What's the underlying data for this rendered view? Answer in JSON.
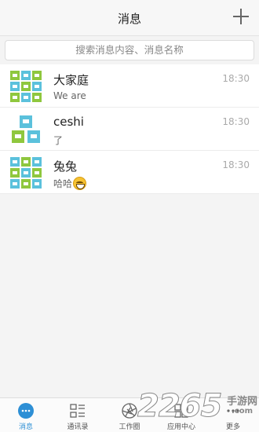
{
  "header": {
    "title": "消息"
  },
  "search": {
    "placeholder": "搜索消息内容、消息名称"
  },
  "conversations": [
    {
      "name": "大家庭",
      "preview": "We are",
      "time": "18:30",
      "avatar": "group-avatar",
      "emoji": ""
    },
    {
      "name": "ceshi",
      "preview": "了",
      "time": "18:30",
      "avatar": "group-avatar-small",
      "emoji": ""
    },
    {
      "name": "兔兔",
      "preview": "哈哈",
      "time": "18:30",
      "avatar": "group-avatar",
      "emoji": "grinning-face"
    }
  ],
  "tabs": [
    {
      "label": "消息",
      "icon": "chat-bubble-icon",
      "active": true
    },
    {
      "label": "通讯录",
      "icon": "contacts-icon",
      "active": false
    },
    {
      "label": "工作圈",
      "icon": "aperture-icon",
      "active": false
    },
    {
      "label": "应用中心",
      "icon": "apps-icon",
      "active": false
    },
    {
      "label": "更多",
      "icon": "more-icon",
      "active": false
    }
  ],
  "watermark": {
    "number": "2265",
    "site_cn": "手游网",
    "site_en": ".com"
  },
  "colors": {
    "accent": "#2d8fd5",
    "avatar_green": "#8fc73e",
    "avatar_blue": "#5bc1dc"
  }
}
